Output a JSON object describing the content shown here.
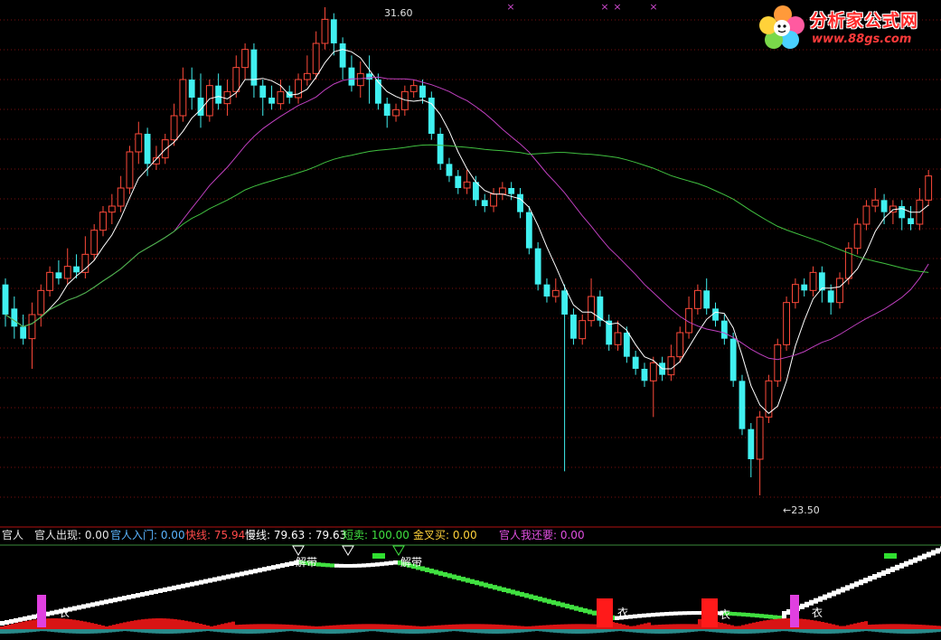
{
  "logo": {
    "title": "分析家公式网",
    "url": "www.88gs.com"
  },
  "main": {
    "high_label": "31.60",
    "low_label": "←23.50",
    "x_markers": [
      "×",
      "×",
      "×",
      "×"
    ]
  },
  "legend": {
    "name": "官人",
    "appear": "官人出现: 0.00",
    "entry": "官人入门: 0.00",
    "fast": "快线: 75.94",
    "slow": "慢线: 79.63 : 79.63",
    "short_sell": "短卖: 100.00",
    "golden_buy": "金叉买: 0.00",
    "want_more": "官人我还要: 0.00"
  },
  "sub": {
    "labels": [
      "解带",
      "解带",
      "衣",
      "衣",
      "衣",
      "衣"
    ]
  },
  "colors": {
    "up": "#ff4a3a",
    "down": "#40f0f0",
    "ma_white": "#ffffff",
    "ma_magenta": "#c040c0",
    "ma_green": "#40c040",
    "grid": "#7a1010"
  },
  "chart_data": {
    "type": "candlestick",
    "y_range": [
      23.5,
      31.6
    ],
    "high": 31.6,
    "low": 23.5,
    "candles": [
      [
        27.0,
        26.5,
        27.1,
        26.3
      ],
      [
        26.6,
        26.3,
        26.8,
        26.1
      ],
      [
        26.3,
        26.1,
        26.5,
        26.0
      ],
      [
        26.1,
        26.5,
        26.7,
        25.6
      ],
      [
        26.5,
        26.9,
        27.0,
        26.3
      ],
      [
        26.9,
        27.2,
        27.3,
        26.8
      ],
      [
        27.2,
        27.1,
        27.4,
        27.0
      ],
      [
        27.1,
        27.3,
        27.6,
        27.0
      ],
      [
        27.3,
        27.2,
        27.5,
        27.1
      ],
      [
        27.2,
        27.5,
        27.8,
        27.1
      ],
      [
        27.5,
        27.9,
        28.0,
        27.4
      ],
      [
        27.9,
        28.2,
        28.3,
        27.8
      ],
      [
        28.2,
        28.3,
        28.5,
        28.0
      ],
      [
        28.3,
        28.6,
        28.8,
        28.2
      ],
      [
        28.6,
        29.2,
        29.3,
        28.5
      ],
      [
        29.2,
        29.5,
        29.7,
        29.0
      ],
      [
        29.5,
        29.0,
        29.6,
        28.8
      ],
      [
        29.0,
        29.1,
        29.3,
        28.9
      ],
      [
        29.1,
        29.4,
        29.5,
        29.0
      ],
      [
        29.4,
        29.8,
        30.0,
        29.3
      ],
      [
        29.8,
        30.4,
        30.6,
        29.7
      ],
      [
        30.4,
        30.1,
        30.6,
        29.9
      ],
      [
        30.1,
        29.8,
        30.5,
        29.6
      ],
      [
        29.8,
        30.3,
        30.4,
        29.7
      ],
      [
        30.3,
        30.0,
        30.5,
        29.9
      ],
      [
        30.0,
        30.2,
        30.4,
        29.8
      ],
      [
        30.2,
        30.6,
        30.8,
        30.1
      ],
      [
        30.6,
        30.9,
        31.0,
        30.4
      ],
      [
        30.9,
        30.3,
        31.0,
        30.1
      ],
      [
        30.3,
        30.1,
        30.4,
        29.8
      ],
      [
        30.1,
        30.0,
        30.3,
        29.9
      ],
      [
        30.0,
        30.2,
        30.4,
        29.9
      ],
      [
        30.2,
        30.1,
        30.3,
        30.0
      ],
      [
        30.1,
        30.4,
        30.5,
        30.0
      ],
      [
        30.4,
        30.5,
        30.8,
        30.3
      ],
      [
        30.5,
        31.0,
        31.2,
        30.4
      ],
      [
        31.0,
        31.4,
        31.6,
        30.9
      ],
      [
        31.4,
        31.0,
        31.5,
        30.8
      ],
      [
        31.0,
        30.6,
        31.1,
        30.4
      ],
      [
        30.6,
        30.3,
        30.8,
        30.2
      ],
      [
        30.3,
        30.5,
        30.7,
        30.1
      ],
      [
        30.5,
        30.4,
        30.8,
        30.0
      ],
      [
        30.4,
        30.0,
        30.5,
        29.9
      ],
      [
        30.0,
        29.8,
        30.1,
        29.6
      ],
      [
        29.8,
        29.9,
        30.0,
        29.7
      ],
      [
        29.9,
        30.2,
        30.3,
        29.8
      ],
      [
        30.2,
        30.3,
        30.4,
        30.1
      ],
      [
        30.3,
        30.1,
        30.4,
        30.0
      ],
      [
        30.1,
        29.5,
        30.2,
        29.4
      ],
      [
        29.5,
        29.0,
        29.6,
        28.9
      ],
      [
        29.0,
        28.8,
        29.1,
        28.7
      ],
      [
        28.8,
        28.6,
        28.9,
        28.5
      ],
      [
        28.6,
        28.7,
        28.9,
        28.5
      ],
      [
        28.7,
        28.4,
        28.8,
        28.3
      ],
      [
        28.4,
        28.3,
        28.5,
        28.2
      ],
      [
        28.3,
        28.5,
        28.6,
        28.2
      ],
      [
        28.5,
        28.6,
        28.7,
        28.4
      ],
      [
        28.6,
        28.5,
        28.7,
        28.4
      ],
      [
        28.5,
        28.2,
        28.6,
        28.1
      ],
      [
        28.2,
        27.6,
        28.3,
        27.5
      ],
      [
        27.6,
        27.0,
        27.7,
        26.9
      ],
      [
        27.0,
        26.8,
        27.1,
        26.7
      ],
      [
        26.8,
        26.9,
        27.1,
        26.7
      ],
      [
        26.9,
        26.5,
        27.0,
        23.9
      ],
      [
        26.5,
        26.1,
        26.6,
        26.0
      ],
      [
        26.1,
        26.4,
        26.5,
        26.0
      ],
      [
        26.4,
        26.8,
        27.1,
        26.3
      ],
      [
        26.8,
        26.4,
        26.9,
        26.3
      ],
      [
        26.4,
        26.0,
        26.5,
        25.9
      ],
      [
        26.0,
        26.2,
        26.4,
        25.9
      ],
      [
        26.2,
        25.8,
        26.3,
        25.7
      ],
      [
        25.8,
        25.6,
        25.9,
        25.5
      ],
      [
        25.6,
        25.4,
        25.7,
        25.3
      ],
      [
        25.4,
        25.7,
        25.8,
        24.8
      ],
      [
        25.7,
        25.5,
        25.8,
        25.4
      ],
      [
        25.5,
        25.8,
        26.0,
        25.4
      ],
      [
        25.8,
        26.2,
        26.3,
        25.7
      ],
      [
        26.2,
        26.6,
        26.8,
        26.1
      ],
      [
        26.6,
        26.9,
        27.0,
        26.5
      ],
      [
        26.9,
        26.6,
        27.1,
        26.5
      ],
      [
        26.6,
        26.4,
        26.7,
        26.3
      ],
      [
        26.4,
        26.1,
        26.5,
        26.0
      ],
      [
        26.1,
        25.4,
        26.2,
        25.3
      ],
      [
        25.4,
        24.6,
        25.5,
        24.5
      ],
      [
        24.6,
        24.1,
        24.7,
        23.8
      ],
      [
        24.1,
        24.8,
        24.9,
        23.5
      ],
      [
        24.8,
        25.4,
        25.5,
        24.7
      ],
      [
        25.4,
        26.0,
        26.1,
        25.3
      ],
      [
        26.0,
        26.7,
        26.8,
        25.9
      ],
      [
        26.7,
        27.0,
        27.1,
        26.6
      ],
      [
        27.0,
        26.9,
        27.1,
        26.8
      ],
      [
        26.9,
        27.2,
        27.3,
        26.8
      ],
      [
        27.2,
        26.9,
        27.3,
        26.7
      ],
      [
        26.9,
        26.7,
        27.0,
        26.5
      ],
      [
        26.7,
        27.1,
        27.2,
        26.6
      ],
      [
        27.1,
        27.6,
        27.7,
        27.0
      ],
      [
        27.6,
        28.0,
        28.1,
        27.5
      ],
      [
        28.0,
        28.3,
        28.4,
        27.9
      ],
      [
        28.3,
        28.4,
        28.6,
        28.2
      ],
      [
        28.4,
        28.2,
        28.5,
        28.0
      ],
      [
        28.2,
        28.3,
        28.4,
        28.0
      ],
      [
        28.3,
        28.1,
        28.4,
        27.9
      ],
      [
        28.1,
        28.0,
        28.3,
        27.9
      ],
      [
        28.0,
        28.4,
        28.6,
        27.9
      ],
      [
        28.4,
        28.8,
        28.9,
        28.3
      ]
    ]
  }
}
